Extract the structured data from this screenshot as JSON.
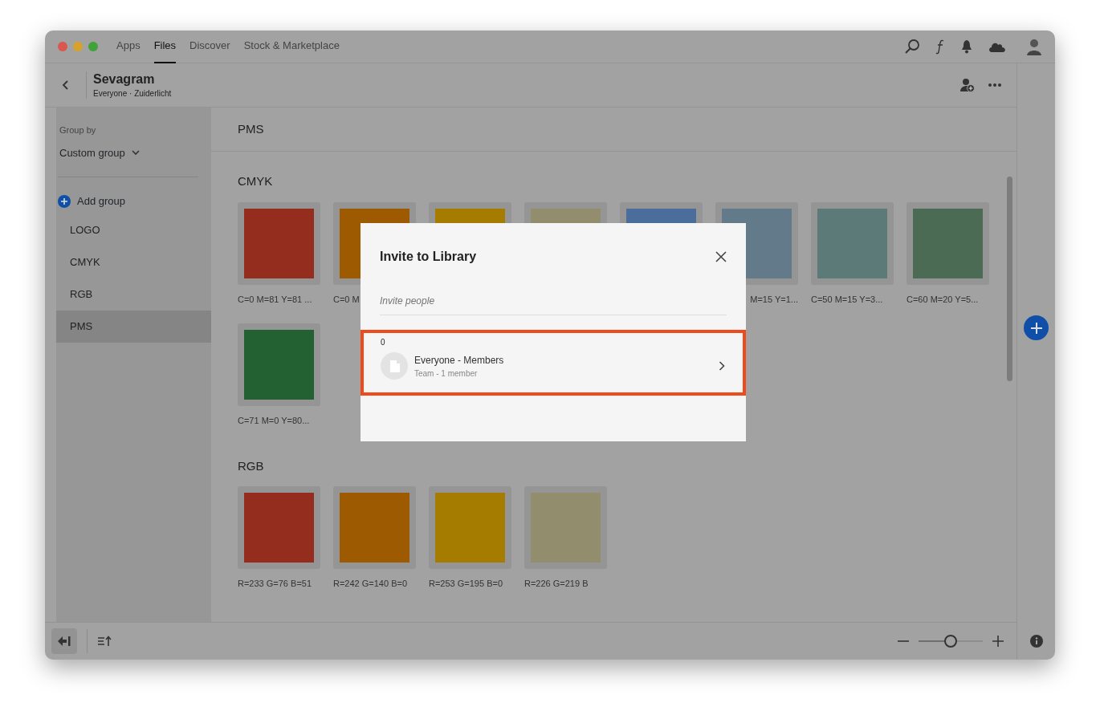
{
  "window": {
    "tabs": [
      {
        "label": "Apps",
        "selected": false
      },
      {
        "label": "Files",
        "selected": true
      },
      {
        "label": "Discover",
        "selected": false
      },
      {
        "label": "Stock & Marketplace",
        "selected": false
      }
    ]
  },
  "header": {
    "title": "Sevagram",
    "subtitle": "Everyone · Zuiderlicht"
  },
  "sidebar": {
    "group_by_label": "Group by",
    "group_by_value": "Custom group",
    "add_button": "Add group",
    "items": [
      {
        "label": "LOGO",
        "selected": false
      },
      {
        "label": "CMYK",
        "selected": false
      },
      {
        "label": "RGB",
        "selected": false
      },
      {
        "label": "PMS",
        "selected": true
      }
    ]
  },
  "content": {
    "title": "PMS",
    "sections": [
      {
        "title": "CMYK",
        "swatches": [
          {
            "color": "#952d1f",
            "label": "C=0 M=81 Y=81 ..."
          },
          {
            "color": "#9d5a00",
            "label": "C=0 M"
          },
          {
            "color": "#a67c00"
          },
          {
            "color": "#928d6c"
          },
          {
            "color": "#4a6d9c"
          },
          {
            "color": "#637a8a",
            "label": "M=15 Y=1...",
            "covered": true
          },
          {
            "color": "#5c7a77",
            "label": "C=50 M=15 Y=3..."
          },
          {
            "color": "#4b6b55",
            "label": "C=60 M=20 Y=5..."
          },
          {
            "color": "#236132",
            "label": "C=71 M=0 Y=80..."
          }
        ]
      },
      {
        "title": "RGB",
        "swatches": [
          {
            "color": "#952d1f",
            "label": "R=233 G=76 B=51"
          },
          {
            "color": "#9d5a00",
            "label": "R=242 G=140 B=0"
          },
          {
            "color": "#a67c00",
            "label": "R=253 G=195 B=0"
          },
          {
            "color": "#928d6c",
            "label": "R=226 G=219 B"
          }
        ]
      }
    ]
  },
  "dialog": {
    "title": "Invite to Library",
    "placeholder": "Invite people",
    "count": "0",
    "result": {
      "name": "Everyone - Members",
      "detail": "Team - 1 member",
      "highlighted": true
    }
  },
  "zoom": {
    "level": 0.5
  }
}
